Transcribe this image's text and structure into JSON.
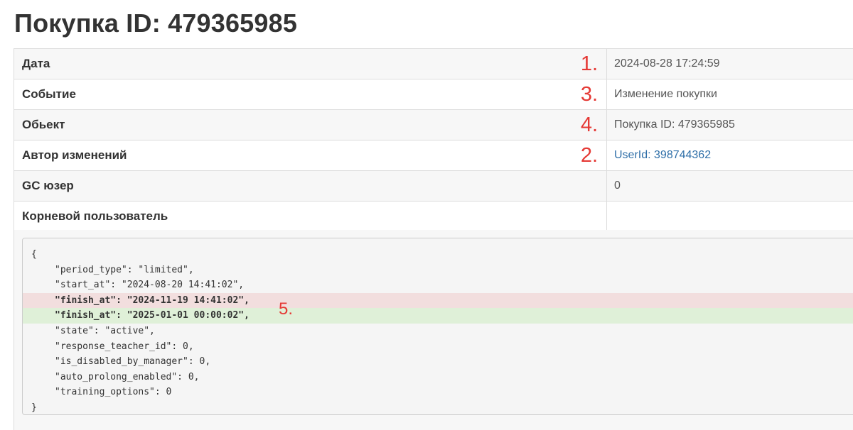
{
  "page": {
    "title": "Покупка ID: 479365985"
  },
  "details": {
    "rows": [
      {
        "label": "Дата",
        "value": "2024-08-28 17:24:59",
        "marker": "1."
      },
      {
        "label": "Событие",
        "value": "Изменение покупки",
        "marker": "3."
      },
      {
        "label": "Обьект",
        "value": "Покупка ID: 479365985",
        "marker": "4."
      },
      {
        "label": "Автор изменений",
        "value": "UserId: 398744362",
        "marker": "2."
      },
      {
        "label": "GC юзер",
        "value": "0"
      },
      {
        "label": "Корневой пользователь",
        "value": ""
      }
    ]
  },
  "code": {
    "marker": "5.",
    "lines": [
      {
        "text": "{",
        "type": "normal"
      },
      {
        "text": "\"period_type\": \"limited\",",
        "type": "normal"
      },
      {
        "text": "\"start_at\": \"2024-08-20 14:41:02\",",
        "type": "normal"
      },
      {
        "text": "\"finish_at\": \"2024-11-19 14:41:02\",",
        "type": "removed"
      },
      {
        "text": "\"finish_at\": \"2025-01-01 00:00:02\",",
        "type": "added"
      },
      {
        "text": "\"state\": \"active\",",
        "type": "normal"
      },
      {
        "text": "\"response_teacher_id\": 0,",
        "type": "normal"
      },
      {
        "text": "\"is_disabled_by_manager\": 0,",
        "type": "normal"
      },
      {
        "text": "\"auto_prolong_enabled\": 0,",
        "type": "normal"
      },
      {
        "text": "\"training_options\": 0",
        "type": "normal"
      },
      {
        "text": "}",
        "type": "normal"
      }
    ]
  },
  "colors": {
    "marker": "#e53935",
    "link": "#2f6fa8",
    "removed_bg": "#f2dede",
    "added_bg": "#dff0d8"
  }
}
